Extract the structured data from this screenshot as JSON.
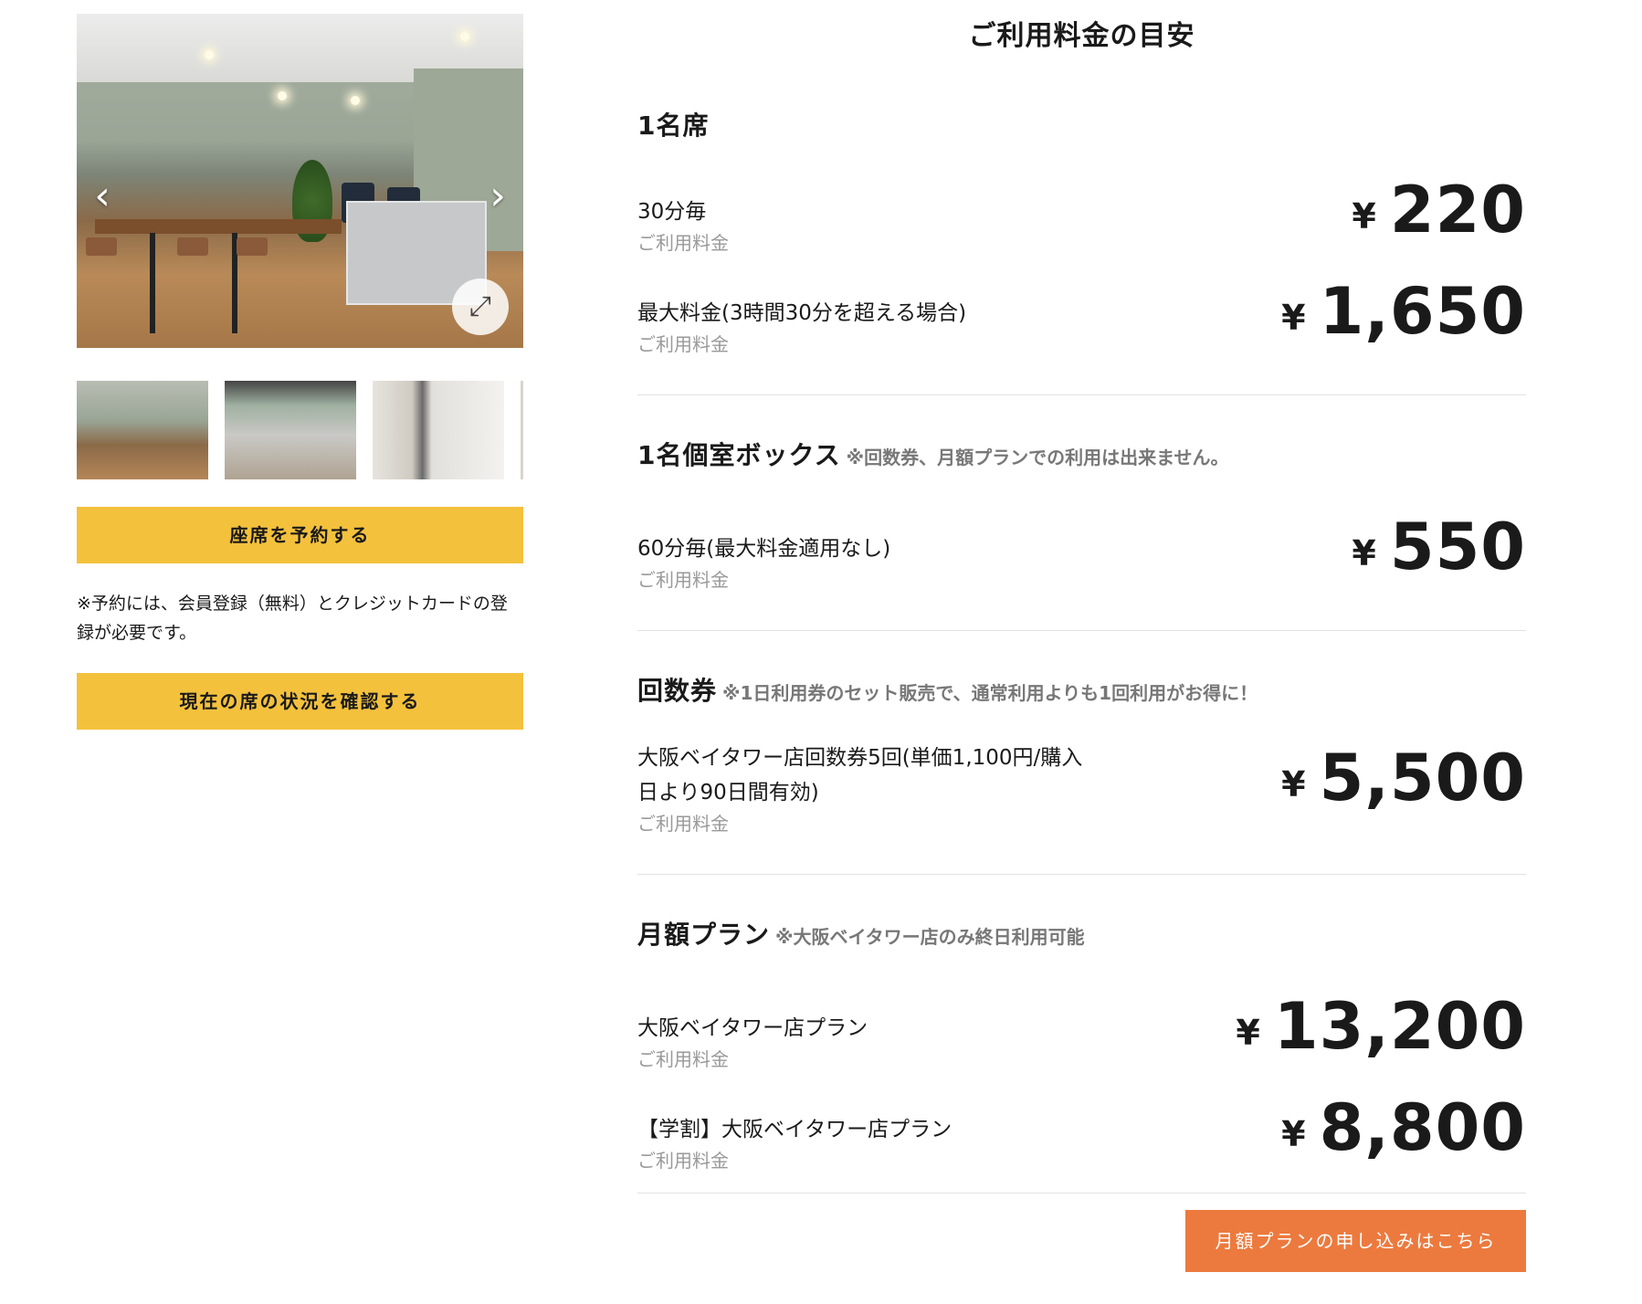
{
  "gallery": {
    "prev_label": "‹",
    "next_label": "›",
    "expand_label": "⤢"
  },
  "actions": {
    "reserve_label": "座席を予約する",
    "note": "※予約には、会員登録（無料）とクレジットカードの登録が必要です。",
    "status_label": "現在の席の状況を確認する"
  },
  "page_title": "ご利用料金の目安",
  "currency_symbol": "¥",
  "sections": [
    {
      "title": "1名席",
      "note": "",
      "rows": [
        {
          "label": "30分毎",
          "sub": "ご利用料金",
          "price": "220"
        },
        {
          "label": "最大料金(3時間30分を超える場合)",
          "sub": "ご利用料金",
          "price": "1,650"
        }
      ]
    },
    {
      "title": "1名個室ボックス",
      "note": "※回数券、月額プランでの利用は出来ません。",
      "rows": [
        {
          "label": "60分毎(最大料金適用なし)",
          "sub": "ご利用料金",
          "price": "550"
        }
      ]
    },
    {
      "title": "回数券",
      "note": "※1日利用券のセット販売で、通常利用よりも1回利用がお得に！",
      "rows": [
        {
          "label": "大阪ベイタワー店回数券5回(単価1,100円/購入日より90日間有効)",
          "sub": "ご利用料金",
          "price": "5,500"
        }
      ]
    },
    {
      "title": "月額プラン",
      "note": "※大阪ベイタワー店のみ終日利用可能",
      "rows": [
        {
          "label": "大阪ベイタワー店プラン",
          "sub": "ご利用料金",
          "price": "13,200"
        },
        {
          "label": "【学割】大阪ベイタワー店プラン",
          "sub": "ご利用料金",
          "price": "8,800"
        }
      ]
    }
  ],
  "apply_label": "月額プランの申し込みはこちら",
  "colors": {
    "button_yellow": "#f4c13d",
    "button_orange": "#ec7a3e",
    "sub_text": "#999999",
    "divider": "#e2e2e2"
  }
}
